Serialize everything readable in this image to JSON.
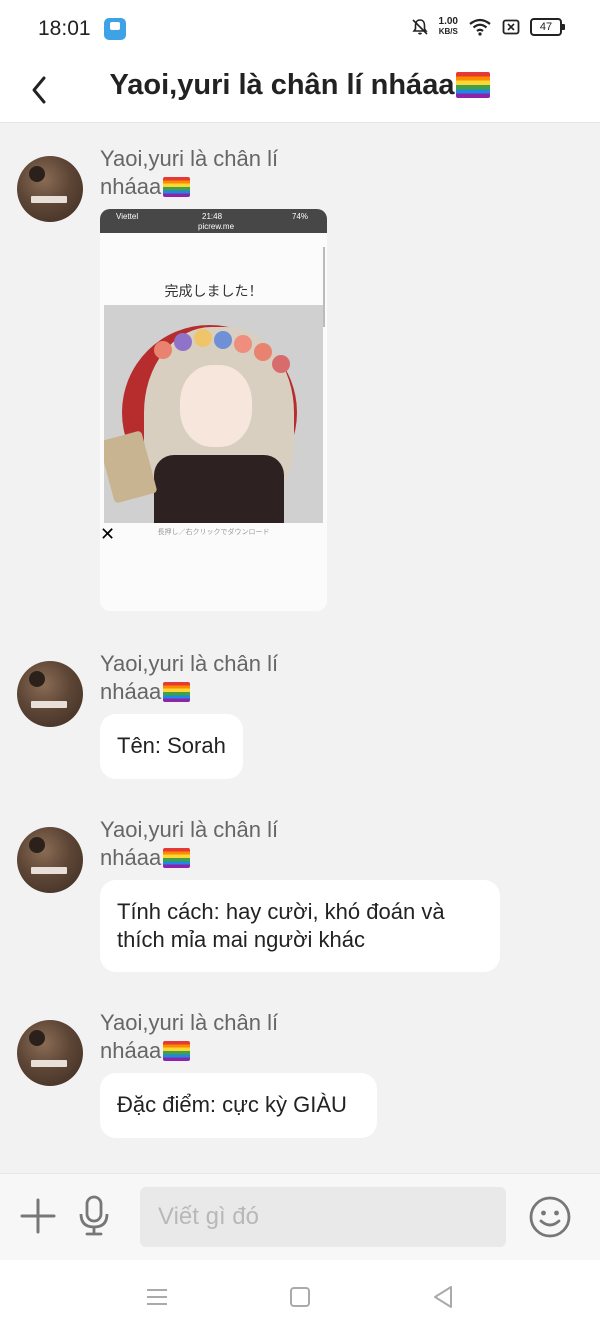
{
  "status_bar": {
    "time": "18:01",
    "net_speed_value": "1.00",
    "net_speed_unit": "KB/S",
    "battery": "47",
    "icons": [
      "app-icon",
      "mute-bell-icon",
      "wifi-icon",
      "sim-icon",
      "battery-icon"
    ]
  },
  "header": {
    "title": "Yaoi,yuri là chân lí nháaa"
  },
  "messages": [
    {
      "type": "image",
      "sender": "Yaoi,yuri là chân lí nháaa",
      "image": {
        "status_carrier": "Viettel",
        "status_time": "21:48",
        "status_battery": "74%",
        "url": "picrew.me",
        "title": "完成しました！",
        "caption": "長押し／右クリックでダウンロード"
      }
    },
    {
      "type": "text",
      "sender": "Yaoi,yuri là chân lí nháaa",
      "text": "Tên: Sorah"
    },
    {
      "type": "text",
      "sender": "Yaoi,yuri là chân lí nháaa",
      "text": "Tính cách: hay cười, khó đoán và thích mỉa mai người khác"
    },
    {
      "type": "text",
      "sender": "Yaoi,yuri là chân lí nháaa",
      "text": "Đặc điểm: cực kỳ GIÀU"
    }
  ],
  "input_bar": {
    "placeholder": "Viết gì đó"
  },
  "colors": {
    "background": "#f2f2f2",
    "bubble": "#ffffff",
    "sender_text": "#666666",
    "input_bg": "#e9e9e9"
  }
}
